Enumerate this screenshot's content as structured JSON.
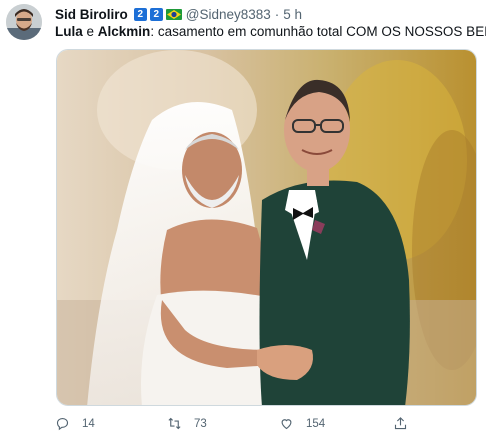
{
  "tweet": {
    "display_name": "Sid Biroliro",
    "badge_1": "2",
    "badge_2": "2",
    "flag_icon": "brazil-flag-icon",
    "handle": "@Sidney8383",
    "separator": "·",
    "time": "5 h",
    "text": {
      "name1": "Lula",
      "conj": " e ",
      "name2": "Alckmin",
      "rest": ": casamento em comunhão total COM OS NOSSOS BENS."
    },
    "media": {
      "type": "photo",
      "description_icon": "wedding-photo"
    }
  },
  "actions": {
    "reply_icon": "reply-icon",
    "reply_count": "14",
    "retweet_icon": "retweet-icon",
    "retweet_count": "73",
    "like_icon": "heart-icon",
    "like_count": "154",
    "share_icon": "share-icon"
  },
  "colors": {
    "text_primary": "#0f1419",
    "text_secondary": "#536471",
    "badge_blue": "#1d6fd6",
    "suit_green": "#1f4338"
  }
}
